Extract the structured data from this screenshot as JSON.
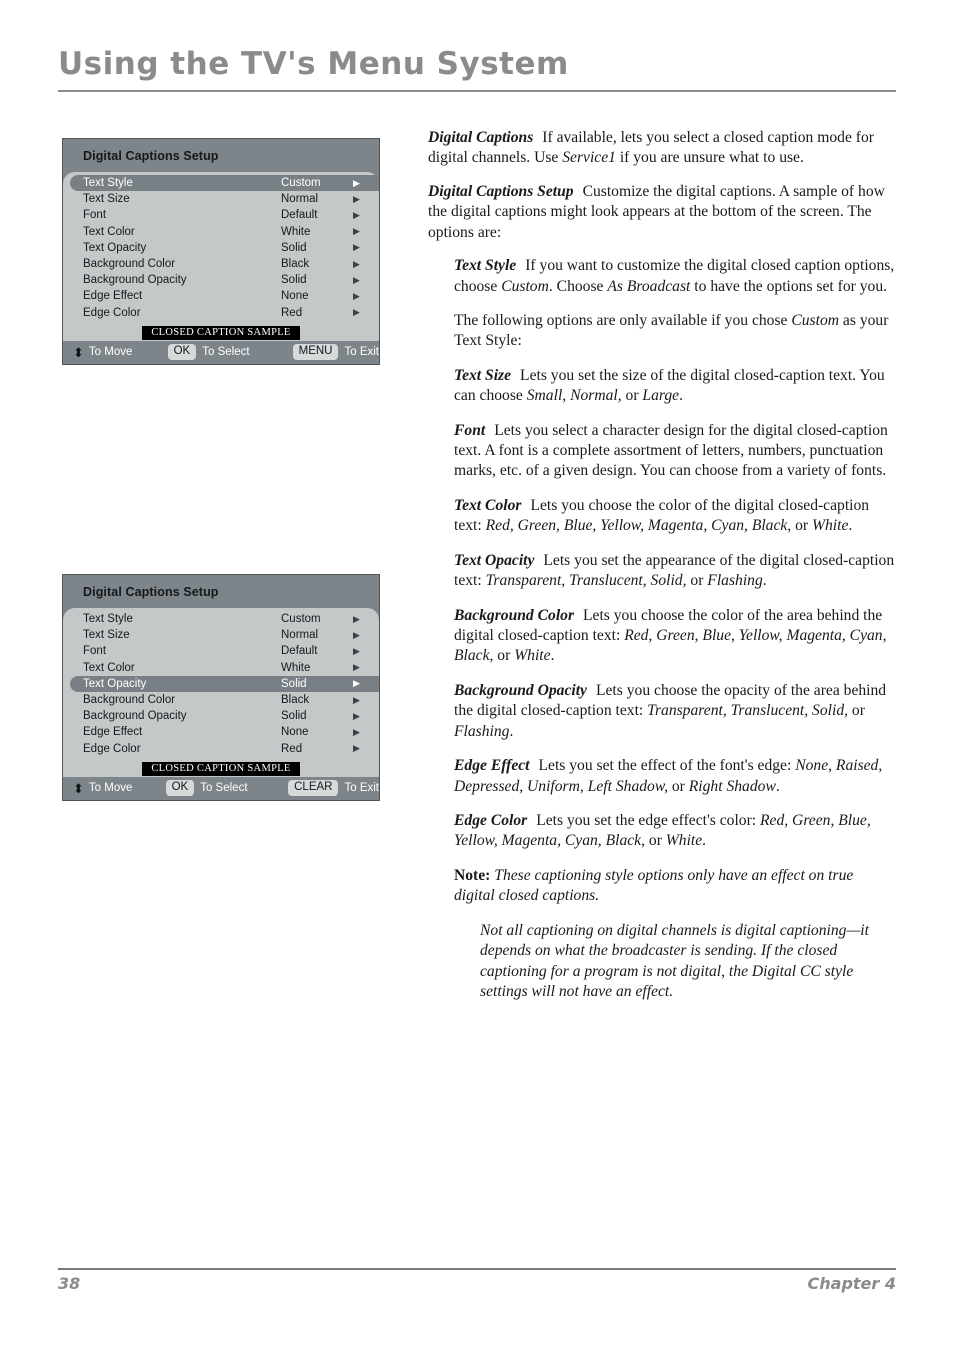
{
  "page": {
    "title": "Using the TV's Menu System",
    "footer_page_number": "38",
    "footer_chapter": "Chapter 4"
  },
  "colors": {
    "title_gray": "#8b8b8b",
    "menu_frame": "#7e858a",
    "menu_list_bg": "#c5c8c9",
    "menu_highlight": "#788086",
    "keycap": "#d7dadb",
    "sample_bg": "#000000"
  },
  "menu_boxes": [
    {
      "title": "Digital Captions Setup",
      "selected_index": 0,
      "rows": [
        {
          "label": "Text Style",
          "value": "Custom",
          "arrow": "right-triangle-icon"
        },
        {
          "label": "Text Size",
          "value": "Normal",
          "arrow": "right-triangle-icon"
        },
        {
          "label": "Font",
          "value": "Default",
          "arrow": "right-triangle-icon"
        },
        {
          "label": "Text Color",
          "value": "White",
          "arrow": "right-triangle-icon"
        },
        {
          "label": "Text Opacity",
          "value": "Solid",
          "arrow": "right-triangle-icon"
        },
        {
          "label": "Background Color",
          "value": "Black",
          "arrow": "right-triangle-icon"
        },
        {
          "label": "Background Opacity",
          "value": "Solid",
          "arrow": "right-triangle-icon"
        },
        {
          "label": "Edge Effect",
          "value": "None",
          "arrow": "right-triangle-icon"
        },
        {
          "label": "Edge Color",
          "value": "Red",
          "arrow": "right-triangle-icon"
        }
      ],
      "sample_text": "CLOSED CAPTION SAMPLE",
      "footer": {
        "move_arrow": "⬍",
        "move_label": "To Move",
        "select_key": "OK",
        "select_label": "To Select",
        "exit_key": "MENU",
        "exit_label": "To Exit"
      }
    },
    {
      "title": "Digital Captions Setup",
      "selected_index": 4,
      "rows": [
        {
          "label": "Text Style",
          "value": "Custom",
          "arrow": "right-triangle-icon"
        },
        {
          "label": "Text Size",
          "value": "Normal",
          "arrow": "right-triangle-icon"
        },
        {
          "label": "Font",
          "value": "Default",
          "arrow": "right-triangle-icon"
        },
        {
          "label": "Text Color",
          "value": "White",
          "arrow": "right-triangle-icon"
        },
        {
          "label": "Text Opacity",
          "value": "Solid",
          "arrow": "right-triangle-icon"
        },
        {
          "label": "Background Color",
          "value": "Black",
          "arrow": "right-triangle-icon"
        },
        {
          "label": "Background Opacity",
          "value": "Solid",
          "arrow": "right-triangle-icon"
        },
        {
          "label": "Edge Effect",
          "value": "None",
          "arrow": "right-triangle-icon"
        },
        {
          "label": "Edge Color",
          "value": "Red",
          "arrow": "right-triangle-icon"
        }
      ],
      "sample_text": "CLOSED CAPTION SAMPLE",
      "footer": {
        "move_arrow": "⬍",
        "move_label": "To Move",
        "select_key": "OK",
        "select_label": "To Select",
        "exit_key": "CLEAR",
        "exit_label": "To Exit"
      }
    }
  ],
  "body": {
    "p1_lead": "Digital Captions",
    "p1_a": "If available, lets you select a closed caption mode for digital channels. Use ",
    "p1_it": "Service1",
    "p1_b": " if you are unsure what to use.",
    "p2_lead": "Digital Captions Setup",
    "p2_a": "Customize the digital captions. A sample of how the digital captions might look appears at the bottom of the screen. The options are:",
    "p3_lead": "Text Style",
    "p3_a": "If you want to customize the digital closed caption options, choose ",
    "p3_it1": "Custom",
    "p3_b": ". Choose ",
    "p3_it2": "As Broadcast",
    "p3_c": " to have the options set for you.",
    "p4_a": "The following options are only available if you chose ",
    "p4_it": "Custom",
    "p4_b": " as your Text Style:",
    "p5_lead": "Text Size",
    "p5_a": "Lets you set the size of the digital closed-caption text. You can choose ",
    "p5_it1": "Small, Normal,",
    "p5_b": " or ",
    "p5_it2": "Large",
    "p5_c": ".",
    "p6_lead": "Font",
    "p6_a": "Lets you select a character design for the digital closed-caption text. A font is a complete assortment of letters, numbers, punctuation marks, etc. of a given design. You can choose from a variety of fonts.",
    "p7_lead": "Text Color",
    "p7_a": "Lets you choose the color of the digital closed-caption text: ",
    "p7_it1": "Red, Green, Blue, Yellow, Magenta, Cyan, Black",
    "p7_b": ", or ",
    "p7_it2": "White",
    "p7_c": ".",
    "p8_lead": "Text Opacity",
    "p8_a": "Lets you set the appearance of the digital closed-caption text: ",
    "p8_it1": "Transparent, Translucent, Solid,",
    "p8_b": " or ",
    "p8_it2": "Flashing",
    "p8_c": ".",
    "p9_lead": "Background Color",
    "p9_a": "Lets you choose the color of the area behind the digital closed-caption text: ",
    "p9_it1": "Red, Green, Blue, Yellow, Magenta, Cyan, Black",
    "p9_b": ", or ",
    "p9_it2": "White",
    "p9_c": ".",
    "p10_lead": "Background Opacity",
    "p10_a": "Lets you choose the opacity of the area behind the digital closed-caption text: ",
    "p10_it1": "Transparent, Translucent, Solid,",
    "p10_b": " or ",
    "p10_it2": "Flashing",
    "p10_c": ".",
    "p11_lead": "Edge Effect",
    "p11_a": "Lets you set the effect of the font's edge: ",
    "p11_it1": "None, Raised, Depressed, Uniform, Left Shadow,",
    "p11_b": " or ",
    "p11_it2": "Right Shadow",
    "p11_c": ".",
    "p12_lead": "Edge Color",
    "p12_a": "Lets you set the edge effect's color: ",
    "p12_it1": "Red, Green, Blue, Yellow, Magenta, Cyan, Black",
    "p12_b": ", or ",
    "p12_it2": "White",
    "p12_c": ".",
    "p13_lead": "Note:",
    "p13_it": " These captioning style options only have an effect on true digital closed captions.",
    "p14_it": "Not all captioning on digital channels is digital captioning—it depends on what the broadcaster is sending. If the closed captioning for a program is not digital, the Digital CC style settings will not have an effect."
  }
}
